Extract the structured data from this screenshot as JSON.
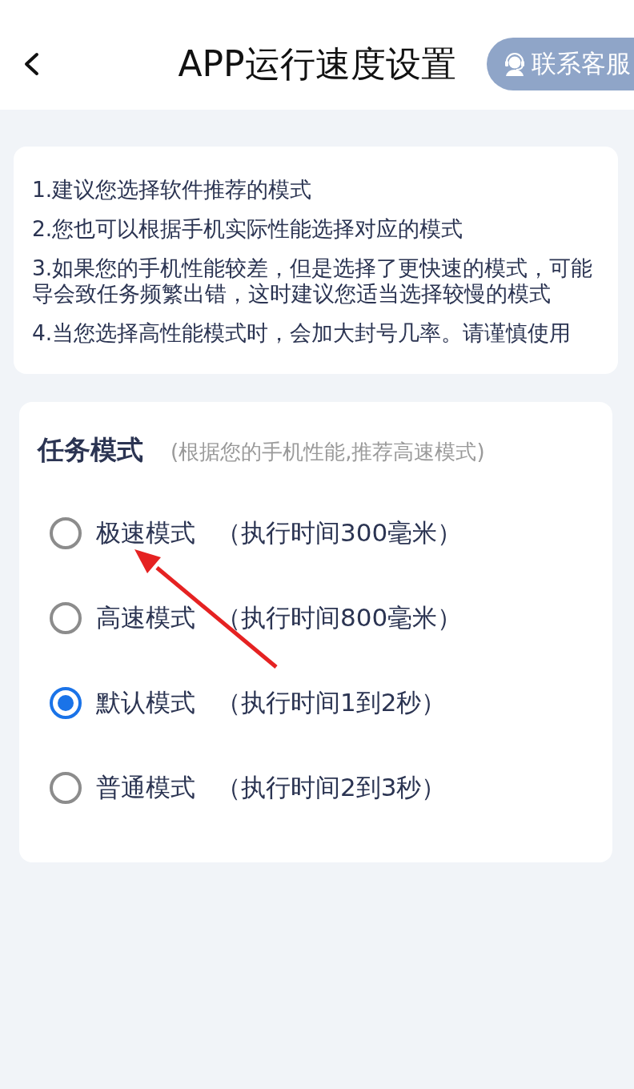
{
  "header": {
    "title": "APP运行速度设置",
    "contact_button": "联系客服"
  },
  "notes": [
    "1.建议您选择软件推荐的模式",
    "2.您也可以根据手机实际性能选择对应的模式",
    "3.如果您的手机性能较差，但是选择了更快速的模式，可能导会致任务频繁出错，这时建议您适当选择较慢的模式",
    "4.当您选择高性能模式时，会加大封号几率。请谨慎使用"
  ],
  "task_mode": {
    "title": "任务模式",
    "hint": "(根据您的手机性能,推荐高速模式)",
    "options": [
      {
        "label": "极速模式",
        "detail": "（执行时间300毫米）",
        "selected": false
      },
      {
        "label": "高速模式",
        "detail": "（执行时间800毫米）",
        "selected": false
      },
      {
        "label": "默认模式",
        "detail": "（执行时间1到2秒）",
        "selected": true
      },
      {
        "label": "普通模式",
        "detail": "（执行时间2到3秒）",
        "selected": false
      }
    ]
  }
}
